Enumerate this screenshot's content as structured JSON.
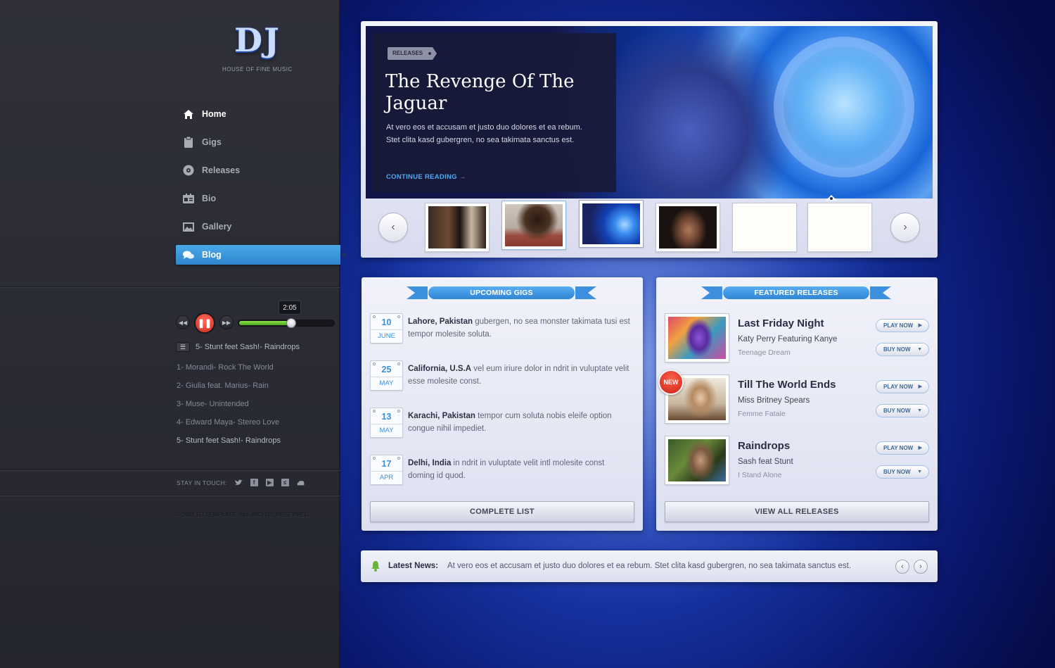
{
  "brand": {
    "logo": "DJ",
    "tagline": "HOUSE OF FINE MUSIC"
  },
  "nav": [
    {
      "label": "Home",
      "icon": "home-icon"
    },
    {
      "label": "Gigs",
      "icon": "clipboard-icon"
    },
    {
      "label": "Releases",
      "icon": "disc-icon"
    },
    {
      "label": "Bio",
      "icon": "id-card-icon"
    },
    {
      "label": "Gallery",
      "icon": "image-icon"
    },
    {
      "label": "Blog",
      "icon": "chat-bubbles-icon"
    }
  ],
  "active_nav": "Blog",
  "player": {
    "time": "2:05",
    "progress": 0.55,
    "now_playing": "5-  Stunt feet Sash!- Raindrops",
    "playlist": [
      "1-  Morandi- Rock The World",
      "2-  Giulia feat. Marius- Rain",
      "3-  Muse-  Unintended",
      "4-  Edward Maya- Stereo Love",
      "5-  Stunt feet Sash!- Raindrops"
    ]
  },
  "social": {
    "label": "STAY IN TOUCH:",
    "icons": [
      "twitter-icon",
      "facebook-icon",
      "youtube-icon",
      "lastfm-icon",
      "soundcloud-icon"
    ]
  },
  "copyright": "© 2011 DJ TEMPLATE. ALL RIGHTS RESERVED.",
  "hero": {
    "tag": "RELEASES",
    "title": "The Revenge Of The Jaguar",
    "body": "At vero eos et accusam et justo duo dolores et ea rebum. Stet clita kasd gubergren, no sea takimata sanctus est.",
    "link": "CONTINUE READING →"
  },
  "gigs": {
    "heading": "UPCOMING GIGS",
    "items": [
      {
        "day": "10",
        "month": "JUNE",
        "place": "Lahore, Pakistan",
        "desc": " gubergen, no sea monster takimata tusi est tempor molesite soluta."
      },
      {
        "day": "25",
        "month": "MAY",
        "place": "California, U.S.A",
        "desc": " vel eum iriure dolor in ndrit in vuluptate velit esse molesite const."
      },
      {
        "day": "13",
        "month": "MAY",
        "place": "Karachi, Pakistan",
        "desc": " tempor cum soluta nobis eleife option congue nihil impediet."
      },
      {
        "day": "17",
        "month": "APR",
        "place": "Delhi, India",
        "desc": " in ndrit in vuluptate velit intl molesite const doming id quod."
      }
    ],
    "button": "COMPLETE LIST"
  },
  "releases": {
    "heading": "FEATURED RELEASES",
    "items": [
      {
        "title": "Last Friday Night",
        "artist": "Katy Perry Featuring Kanye",
        "album": "Teenage Dream",
        "play": "PLAY NOW",
        "buy": "BUY NOW"
      },
      {
        "title": "Till The World Ends",
        "artist": "Miss Britney Spears",
        "album": "Femme Fatale",
        "play": "PLAY NOW",
        "buy": "BUY NOW",
        "badge": "NEW"
      },
      {
        "title": "Raindrops",
        "artist": "Sash feat Stunt",
        "album": "I Stand Alone",
        "play": "PLAY NOW",
        "buy": "BUY NOW"
      }
    ],
    "button": "VIEW ALL RELEASES"
  },
  "news": {
    "label": "Latest News:",
    "text": "At vero eos et accusam et justo duo dolores et ea rebum. Stet clita kasd gubergren, no sea takimata sanctus est."
  },
  "colors": {
    "accent": "#3b8fdc",
    "new_badge": "#d8301f",
    "progress": "#6fc634"
  }
}
